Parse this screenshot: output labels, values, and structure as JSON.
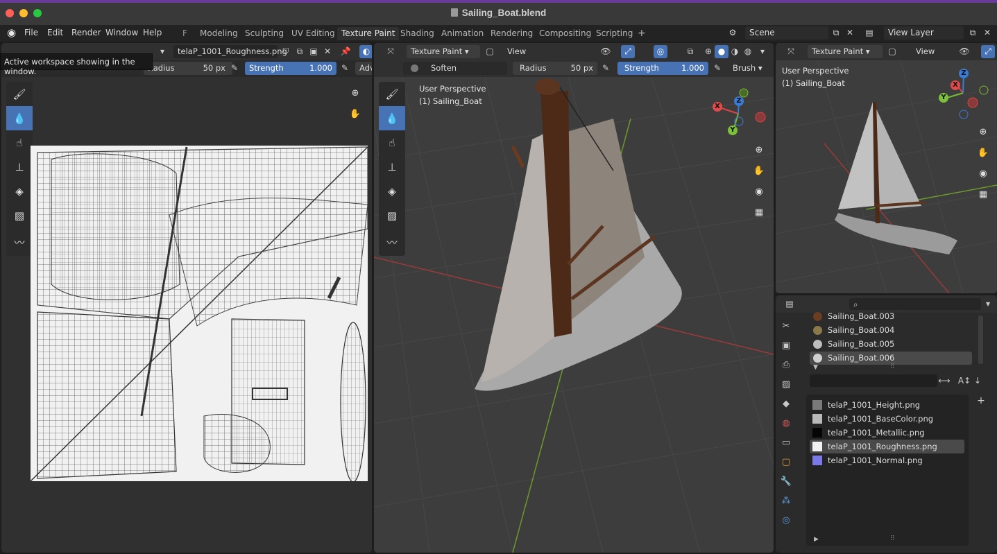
{
  "window": {
    "title": "Sailing_Boat.blend"
  },
  "menubar": {
    "menus": [
      "File",
      "Edit",
      "Render",
      "Window",
      "Help"
    ],
    "f_label": "F",
    "workspaces": [
      "Modeling",
      "Sculpting",
      "UV Editing",
      "Texture Paint",
      "Shading",
      "Animation",
      "Rendering",
      "Compositing",
      "Scripting"
    ],
    "add_tab": "+",
    "scene": "Scene",
    "view_layer": "View Layer"
  },
  "tooltip": "Active workspace showing in the window.",
  "image_editor": {
    "image_name": "telaP_1001_Roughness.png",
    "radius_label": "Radius",
    "radius_value": "50 px",
    "strength_label": "Strength",
    "strength_value": "1.000",
    "adv_label": "Adv"
  },
  "viewport_main": {
    "mode": "Texture Paint",
    "view_menu": "View",
    "brush_name": "Soften",
    "radius_label": "Radius",
    "radius_value": "50 px",
    "strength_label": "Strength",
    "strength_value": "1.000",
    "brush_menu": "Brush",
    "perspective": "User Perspective",
    "object": "(1) Sailing_Boat",
    "gizmo": {
      "x": "X",
      "y": "Y",
      "z": "Z"
    }
  },
  "viewport_small": {
    "mode": "Texture Paint",
    "view_menu": "View",
    "perspective": "User Perspective",
    "object": "(1) Sailing_Boat",
    "gizmo": {
      "x": "X",
      "y": "Y",
      "z": "Z"
    }
  },
  "properties": {
    "materials": [
      {
        "name": "Sailing_Boat.003",
        "color": "#6b3d22",
        "selected": false
      },
      {
        "name": "Sailing_Boat.004",
        "color": "#8a7a4a",
        "selected": false
      },
      {
        "name": "Sailing_Boat.005",
        "color": "#bdbdbd",
        "selected": false
      },
      {
        "name": "Sailing_Boat.006",
        "color": "#d0d0d0",
        "selected": true
      }
    ],
    "images": [
      {
        "name": "telaP_1001_Height.png",
        "color": "#7a7a7a",
        "selected": false
      },
      {
        "name": "telaP_1001_BaseColor.png",
        "color": "#b8b8b8",
        "selected": false
      },
      {
        "name": "telaP_1001_Metallic.png",
        "color": "#050505",
        "selected": false
      },
      {
        "name": "telaP_1001_Roughness.png",
        "color": "#f2f2f2",
        "selected": true
      },
      {
        "name": "telaP_1001_Normal.png",
        "color": "#7b78e8",
        "selected": false
      }
    ],
    "add_button": "+"
  }
}
